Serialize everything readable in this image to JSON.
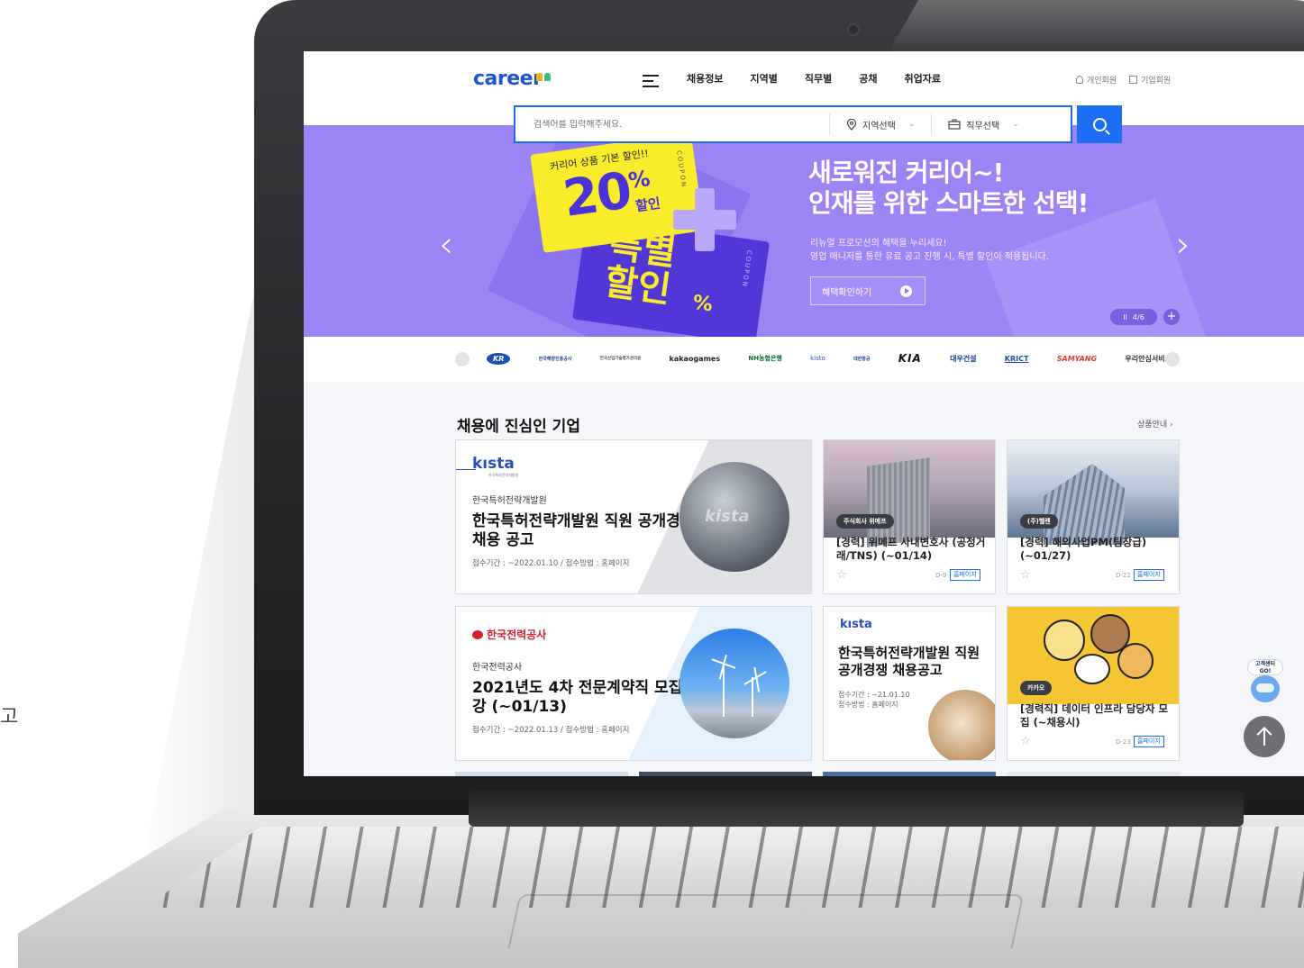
{
  "outside_text": "고",
  "header": {
    "logo": "career",
    "nav": [
      "채용정보",
      "지역별",
      "직무별",
      "공채",
      "취업자료"
    ],
    "user_links": {
      "personal": "개인회원",
      "company": "기업회원"
    }
  },
  "search": {
    "placeholder": "검색어를 입력해주세요.",
    "region": "지역선택",
    "job": "직무선택"
  },
  "banner": {
    "coupon_sub": "커리어 상품 기본 할인!!",
    "coupon_big": "20",
    "coupon_pct": "%",
    "coupon_hal": "할인",
    "coupon_word": "COUPON",
    "special_1": "특별",
    "special_2": "할인",
    "special_pct": "%",
    "title_1": "새로워진 커리어~!",
    "title_2": "인재를 위한 스마트한 선택!",
    "desc_1": "리뉴얼 프로모션의 혜택을 누리세요!",
    "desc_2": "영업 매니저를 통한 유료 공고 진행 시, 특별 할인이 적용됩니다.",
    "button": "혜택확인하기",
    "pager_pause": "II",
    "pager": "4/6",
    "pager_plus": "+"
  },
  "logos": [
    "KR",
    "한국해양진흥공사",
    "한국산업기술평가관리원",
    "kakaogames",
    "NH농협은행",
    "kisto",
    "대한항공",
    "KIA",
    "대우건설",
    "KRICT",
    "SAMYANG",
    "우리안심서비스"
  ],
  "section": {
    "title": "채용에 진심인 기업",
    "link": "상품안내 ›"
  },
  "cards": {
    "kisto_big": {
      "logo": "kısta",
      "logo_sub": "한국특허전략개발원",
      "company": "한국특허전략개발원",
      "title": "한국특허전략개발원 직원 공개경쟁 채용 공고",
      "meta": "접수기간 : ~2022.01.10  /  접수방법 : 홈페이지",
      "globe_text": "kista"
    },
    "wemakeprice": {
      "tag": "주식회사 위메프",
      "title": "[경력] 위메프 사내변호사 (공정거래/TNS) (~01/14)",
      "dday": "D-9",
      "hp": "홈페이지"
    },
    "hellen": {
      "tag": "(주)헬렌",
      "title": "[경력] 해외사업PM(팀장급) (~01/27)",
      "dday": "D-22",
      "hp": "홈페이지"
    },
    "kepco": {
      "logo": "한국전력공사",
      "company": "한국전력공사",
      "title": "2021년도 4차 전문계약직 모집요강 (~01/13)",
      "meta": "접수기간 : ~2022.01.13  /  접수방법 : 홈페이지"
    },
    "kisto_mid": {
      "logo": "kısta",
      "title": "한국특허전략개발원 직원 공개경쟁 채용공고",
      "meta_1": "접수기간 : ~21.01.10",
      "meta_2": "접수방법 : 홈페이지"
    },
    "kakao": {
      "tag": "카카오",
      "title": "[경력직] 데이터 인프라 담당자 모집 (~채용시)",
      "dday": "D-23",
      "hp": "홈페이지"
    }
  },
  "side": {
    "cs_1": "고객센터",
    "cs_2": "GO!"
  }
}
